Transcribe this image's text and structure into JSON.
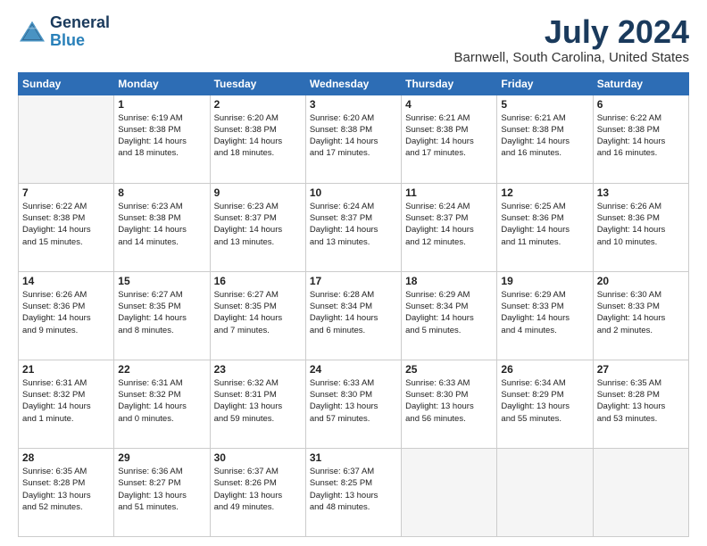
{
  "logo": {
    "line1": "General",
    "line2": "Blue"
  },
  "title": "July 2024",
  "subtitle": "Barnwell, South Carolina, United States",
  "header_days": [
    "Sunday",
    "Monday",
    "Tuesday",
    "Wednesday",
    "Thursday",
    "Friday",
    "Saturday"
  ],
  "weeks": [
    [
      {
        "day": "",
        "info": ""
      },
      {
        "day": "1",
        "info": "Sunrise: 6:19 AM\nSunset: 8:38 PM\nDaylight: 14 hours\nand 18 minutes."
      },
      {
        "day": "2",
        "info": "Sunrise: 6:20 AM\nSunset: 8:38 PM\nDaylight: 14 hours\nand 18 minutes."
      },
      {
        "day": "3",
        "info": "Sunrise: 6:20 AM\nSunset: 8:38 PM\nDaylight: 14 hours\nand 17 minutes."
      },
      {
        "day": "4",
        "info": "Sunrise: 6:21 AM\nSunset: 8:38 PM\nDaylight: 14 hours\nand 17 minutes."
      },
      {
        "day": "5",
        "info": "Sunrise: 6:21 AM\nSunset: 8:38 PM\nDaylight: 14 hours\nand 16 minutes."
      },
      {
        "day": "6",
        "info": "Sunrise: 6:22 AM\nSunset: 8:38 PM\nDaylight: 14 hours\nand 16 minutes."
      }
    ],
    [
      {
        "day": "7",
        "info": "Sunrise: 6:22 AM\nSunset: 8:38 PM\nDaylight: 14 hours\nand 15 minutes."
      },
      {
        "day": "8",
        "info": "Sunrise: 6:23 AM\nSunset: 8:38 PM\nDaylight: 14 hours\nand 14 minutes."
      },
      {
        "day": "9",
        "info": "Sunrise: 6:23 AM\nSunset: 8:37 PM\nDaylight: 14 hours\nand 13 minutes."
      },
      {
        "day": "10",
        "info": "Sunrise: 6:24 AM\nSunset: 8:37 PM\nDaylight: 14 hours\nand 13 minutes."
      },
      {
        "day": "11",
        "info": "Sunrise: 6:24 AM\nSunset: 8:37 PM\nDaylight: 14 hours\nand 12 minutes."
      },
      {
        "day": "12",
        "info": "Sunrise: 6:25 AM\nSunset: 8:36 PM\nDaylight: 14 hours\nand 11 minutes."
      },
      {
        "day": "13",
        "info": "Sunrise: 6:26 AM\nSunset: 8:36 PM\nDaylight: 14 hours\nand 10 minutes."
      }
    ],
    [
      {
        "day": "14",
        "info": "Sunrise: 6:26 AM\nSunset: 8:36 PM\nDaylight: 14 hours\nand 9 minutes."
      },
      {
        "day": "15",
        "info": "Sunrise: 6:27 AM\nSunset: 8:35 PM\nDaylight: 14 hours\nand 8 minutes."
      },
      {
        "day": "16",
        "info": "Sunrise: 6:27 AM\nSunset: 8:35 PM\nDaylight: 14 hours\nand 7 minutes."
      },
      {
        "day": "17",
        "info": "Sunrise: 6:28 AM\nSunset: 8:34 PM\nDaylight: 14 hours\nand 6 minutes."
      },
      {
        "day": "18",
        "info": "Sunrise: 6:29 AM\nSunset: 8:34 PM\nDaylight: 14 hours\nand 5 minutes."
      },
      {
        "day": "19",
        "info": "Sunrise: 6:29 AM\nSunset: 8:33 PM\nDaylight: 14 hours\nand 4 minutes."
      },
      {
        "day": "20",
        "info": "Sunrise: 6:30 AM\nSunset: 8:33 PM\nDaylight: 14 hours\nand 2 minutes."
      }
    ],
    [
      {
        "day": "21",
        "info": "Sunrise: 6:31 AM\nSunset: 8:32 PM\nDaylight: 14 hours\nand 1 minute."
      },
      {
        "day": "22",
        "info": "Sunrise: 6:31 AM\nSunset: 8:32 PM\nDaylight: 14 hours\nand 0 minutes."
      },
      {
        "day": "23",
        "info": "Sunrise: 6:32 AM\nSunset: 8:31 PM\nDaylight: 13 hours\nand 59 minutes."
      },
      {
        "day": "24",
        "info": "Sunrise: 6:33 AM\nSunset: 8:30 PM\nDaylight: 13 hours\nand 57 minutes."
      },
      {
        "day": "25",
        "info": "Sunrise: 6:33 AM\nSunset: 8:30 PM\nDaylight: 13 hours\nand 56 minutes."
      },
      {
        "day": "26",
        "info": "Sunrise: 6:34 AM\nSunset: 8:29 PM\nDaylight: 13 hours\nand 55 minutes."
      },
      {
        "day": "27",
        "info": "Sunrise: 6:35 AM\nSunset: 8:28 PM\nDaylight: 13 hours\nand 53 minutes."
      }
    ],
    [
      {
        "day": "28",
        "info": "Sunrise: 6:35 AM\nSunset: 8:28 PM\nDaylight: 13 hours\nand 52 minutes."
      },
      {
        "day": "29",
        "info": "Sunrise: 6:36 AM\nSunset: 8:27 PM\nDaylight: 13 hours\nand 51 minutes."
      },
      {
        "day": "30",
        "info": "Sunrise: 6:37 AM\nSunset: 8:26 PM\nDaylight: 13 hours\nand 49 minutes."
      },
      {
        "day": "31",
        "info": "Sunrise: 6:37 AM\nSunset: 8:25 PM\nDaylight: 13 hours\nand 48 minutes."
      },
      {
        "day": "",
        "info": ""
      },
      {
        "day": "",
        "info": ""
      },
      {
        "day": "",
        "info": ""
      }
    ]
  ]
}
